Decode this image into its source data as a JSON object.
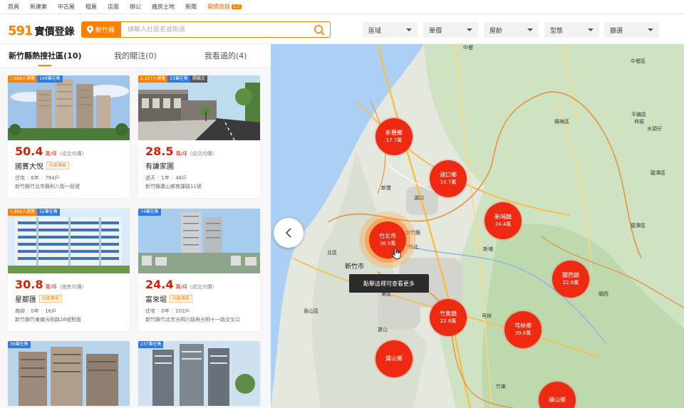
{
  "topnav": {
    "items": [
      "首頁",
      "新建案",
      "中古屋",
      "租屋",
      "店面",
      "辦公",
      "廠房土地",
      "新聞",
      "實價登錄"
    ],
    "active_index": 8,
    "hot_badge": "1.0"
  },
  "header": {
    "logo_number": "591",
    "logo_text": "實價登錄",
    "city_button": "新竹縣",
    "search_placeholder": "請輸入社區名或街道",
    "filters": [
      "區域",
      "單價",
      "屋齡",
      "型態",
      "篩選"
    ]
  },
  "tabs": [
    "新竹縣熱搜社區(10)",
    "我的關注(0)",
    "我看過的(4)"
  ],
  "cards": [
    {
      "b1": "2,696人瀏覽",
      "b2": "149筆在售",
      "b3": "",
      "price": "50.4",
      "unit": "萬/坪",
      "ptype": "(成交均價)",
      "name": "國賓大悅",
      "tag": "社區專家",
      "m1": "住宅",
      "m2": "6年",
      "m3": "794戶",
      "addr": "新竹縣竹北市縣利八街一段號"
    },
    {
      "b1": "2,287人瀏覽",
      "b2": "23筆在售",
      "b3": "開箱文",
      "price": "28.5",
      "unit": "萬/坪",
      "ptype": "(成交均價)",
      "name": "有謙家園",
      "tag": "",
      "m1": "透天",
      "m2": "1年",
      "m3": "48戶",
      "addr": "新竹縣寶山鄉育課路11號"
    },
    {
      "b1": "1,990人瀏覽",
      "b2": "52筆在售",
      "b3": "",
      "price": "30.8",
      "unit": "萬/坪",
      "ptype": "(銷售均價)",
      "name": "星都匯",
      "tag": "社區專家",
      "m1": "商辦",
      "m2": "0年",
      "m3": "16戶",
      "addr": "新竹縣竹東鎮光明路26號對面"
    },
    {
      "b1": "",
      "b2": "74筆在售",
      "b3": "",
      "price": "24.4",
      "unit": "萬/坪",
      "ptype": "(成交均價)",
      "name": "富來堀",
      "tag": "社區專家",
      "m1": "住宅",
      "m2": "0年",
      "m3": "102戶",
      "addr": "新竹縣竹北市光明六路與光明十一路交叉口"
    },
    {
      "b1": "",
      "b2": "36筆在售",
      "b3": ""
    },
    {
      "b1": "",
      "b2": "237筆在售",
      "b3": ""
    }
  ],
  "map": {
    "bubbles": [
      {
        "name": "新豐鄉",
        "price": "17.7萬"
      },
      {
        "name": "湖口鄉",
        "price": "19.7萬"
      },
      {
        "name": "新埔鎮",
        "price": "24.4萬"
      },
      {
        "name": "竹北市",
        "price": "36.9萬"
      },
      {
        "name": "關西鎮",
        "price": "22.6萬"
      },
      {
        "name": "竹東鎮",
        "price": "22.8萬"
      },
      {
        "name": "芎林鄉",
        "price": "39.8萬"
      },
      {
        "name": "寶山鄉",
        "price": ""
      },
      {
        "name": "橫山鄉",
        "price": ""
      }
    ],
    "tooltip": "點擊這裡可查看更多",
    "labels": [
      "中壢區",
      "平鎮區",
      "楊梅區",
      "龍潭區",
      "新豐",
      "湖口",
      "新竹縣",
      "竹北",
      "北區",
      "新竹市",
      "東區",
      "香山區",
      "寶山",
      "竹東",
      "芎林",
      "關西",
      "龍潭區",
      "新埔",
      "林振",
      "水頭仔",
      "竹北市",
      "中壢"
    ]
  },
  "colors": {
    "accent": "#ff8000",
    "bubble": "#ee2a13",
    "price": "#d81e06"
  }
}
